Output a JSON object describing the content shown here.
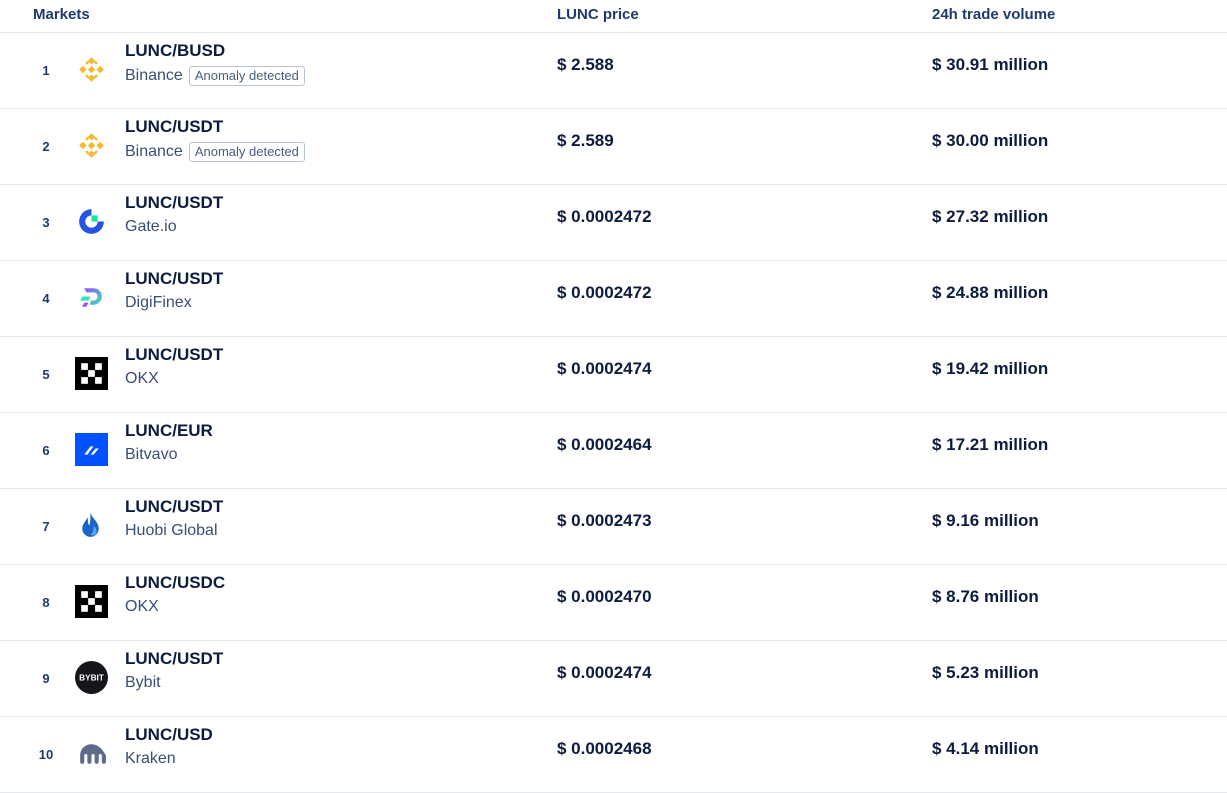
{
  "header": {
    "markets": "Markets",
    "price": "LUNC price",
    "volume": "24h trade volume"
  },
  "rows": [
    {
      "rank": "1",
      "pair": "LUNC/BUSD",
      "exchange": "Binance",
      "badge": "Anomaly detected",
      "price": "$ 2.588",
      "volume": "$ 30.91 million",
      "icon": "binance-icon"
    },
    {
      "rank": "2",
      "pair": "LUNC/USDT",
      "exchange": "Binance",
      "badge": "Anomaly detected",
      "price": "$ 2.589",
      "volume": "$ 30.00 million",
      "icon": "binance-icon"
    },
    {
      "rank": "3",
      "pair": "LUNC/USDT",
      "exchange": "Gate.io",
      "price": "$ 0.0002472",
      "volume": "$ 27.32 million",
      "icon": "gateio-icon"
    },
    {
      "rank": "4",
      "pair": "LUNC/USDT",
      "exchange": "DigiFinex",
      "price": "$ 0.0002472",
      "volume": "$ 24.88 million",
      "icon": "digifinex-icon"
    },
    {
      "rank": "5",
      "pair": "LUNC/USDT",
      "exchange": "OKX",
      "price": "$ 0.0002474",
      "volume": "$ 19.42 million",
      "icon": "okx-icon"
    },
    {
      "rank": "6",
      "pair": "LUNC/EUR",
      "exchange": "Bitvavo",
      "price": "$ 0.0002464",
      "volume": "$ 17.21 million",
      "icon": "bitvavo-icon"
    },
    {
      "rank": "7",
      "pair": "LUNC/USDT",
      "exchange": "Huobi Global",
      "price": "$ 0.0002473",
      "volume": "$ 9.16 million",
      "icon": "huobi-icon"
    },
    {
      "rank": "8",
      "pair": "LUNC/USDC",
      "exchange": "OKX",
      "price": "$ 0.0002470",
      "volume": "$ 8.76 million",
      "icon": "okx-icon"
    },
    {
      "rank": "9",
      "pair": "LUNC/USDT",
      "exchange": "Bybit",
      "price": "$ 0.0002474",
      "volume": "$ 5.23 million",
      "icon": "bybit-icon",
      "icon_text": "BYBIT"
    },
    {
      "rank": "10",
      "pair": "LUNC/USD",
      "exchange": "Kraken",
      "price": "$ 0.0002468",
      "volume": "$ 4.14 million",
      "icon": "kraken-icon"
    }
  ],
  "colors": {
    "binance": "#f3ba2f",
    "gateio": "#2354e6",
    "gateio_accent": "#17e6a1",
    "digifinex_start": "#9b4dff",
    "digifinex_end": "#2ee6b8",
    "okx": "#000000",
    "bitvavo": "#0051ff",
    "huobi": "#1a63c7",
    "kraken": "#5e6b8a"
  }
}
